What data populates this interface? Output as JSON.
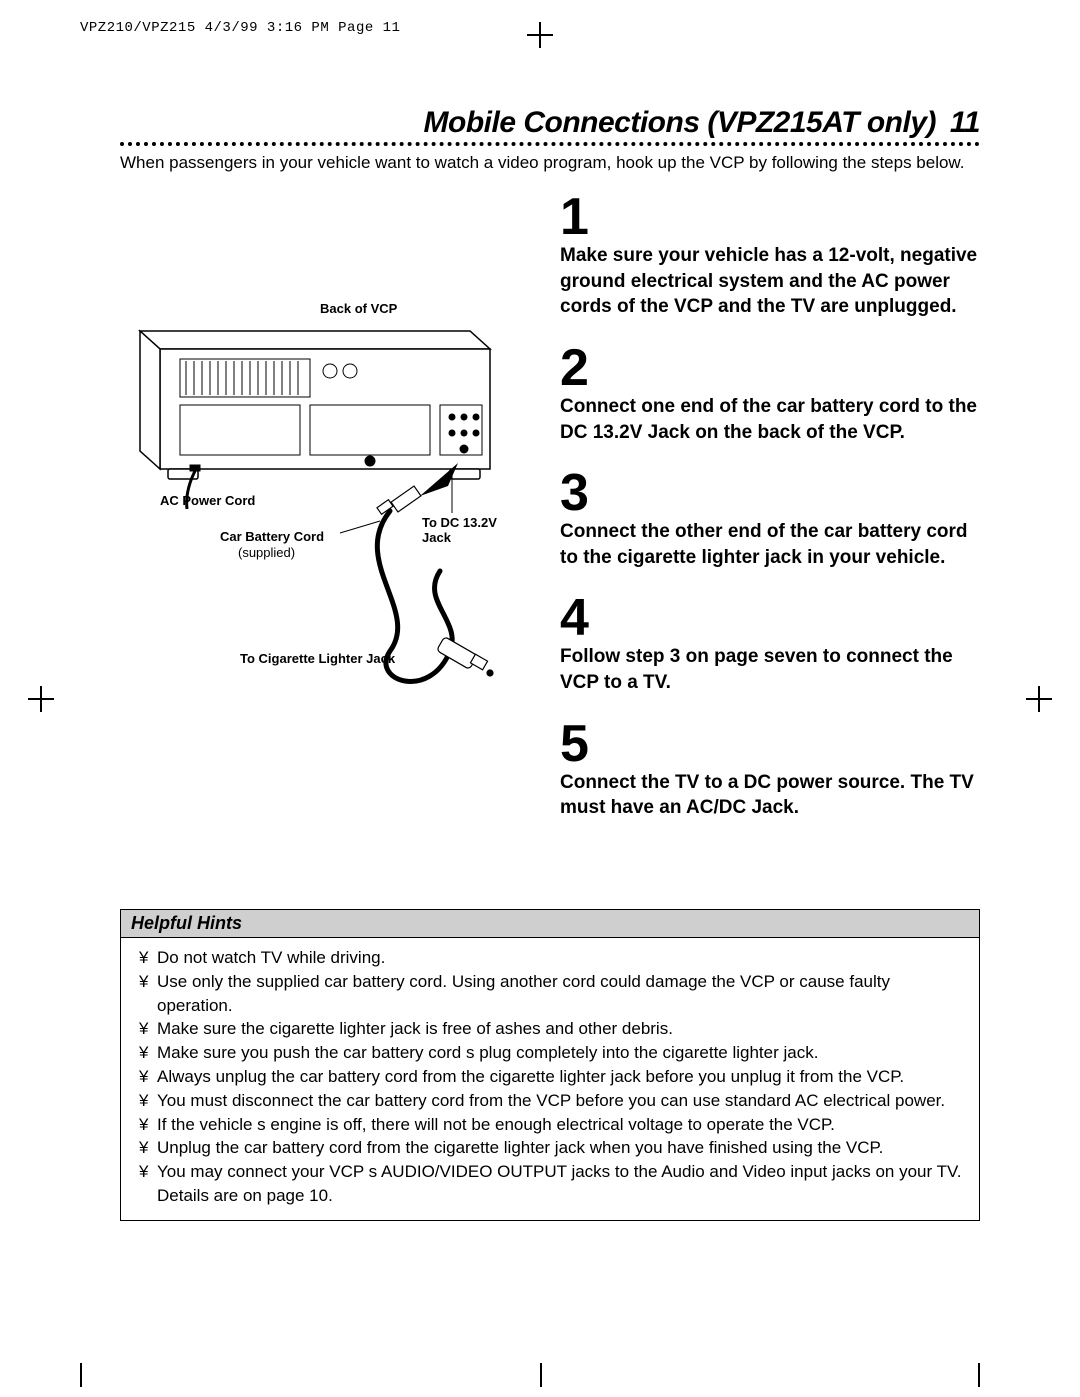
{
  "meta_header": "VPZ210/VPZ215  4/3/99 3:16 PM  Page 11",
  "title": "Mobile Connections (VPZ215AT only)",
  "page_number": "11",
  "intro": "When passengers in your vehicle want to watch a video program, hook up the VCP by following the steps below.",
  "diagram": {
    "back_label": "Back of  VCP",
    "ac_cord_label": "AC Power Cord",
    "car_cord_label": "Car Battery Cord",
    "car_cord_sub": "(supplied)",
    "dc_jack_label": "To DC 13.2V Jack",
    "cig_label": "To Cigarette Lighter Jack"
  },
  "steps": [
    {
      "num": "1",
      "text": "Make sure your vehicle has a 12-volt, negative ground electrical system and the AC power cords of the VCP and the TV are unplugged."
    },
    {
      "num": "2",
      "text": "Connect one end of the car battery cord to the DC 13.2V Jack on the back of the VCP."
    },
    {
      "num": "3",
      "text": "Connect the other end of the car battery cord to the cigarette lighter jack in your vehicle."
    },
    {
      "num": "4",
      "text": "Follow step 3 on page seven to connect the VCP to a TV."
    },
    {
      "num": "5",
      "text": "Connect the TV to a DC power source.  The TV must have an AC/DC Jack."
    }
  ],
  "hints_title": "Helpful Hints",
  "hints": [
    "Do not watch TV while driving.",
    "Use only the supplied car battery cord. Using another cord could damage the VCP or cause faulty operation.",
    "Make sure the cigarette lighter jack is free of ashes and other debris.",
    "Make sure you push the car battery cord s plug completely into the cigarette lighter jack.",
    "Always unplug the car battery cord from the cigarette lighter jack before you unplug it from the VCP.",
    "You must disconnect the car battery cord from the VCP before you can use standard AC electrical power.",
    "If the vehicle s engine is off, there will not be enough electrical voltage to operate the VCP.",
    "Unplug the car battery cord from the cigarette lighter jack when you have finished using the VCP.",
    "You may connect your VCP s AUDIO/VIDEO OUTPUT jacks to the Audio and Video input jacks on your TV. Details are on page 10."
  ]
}
